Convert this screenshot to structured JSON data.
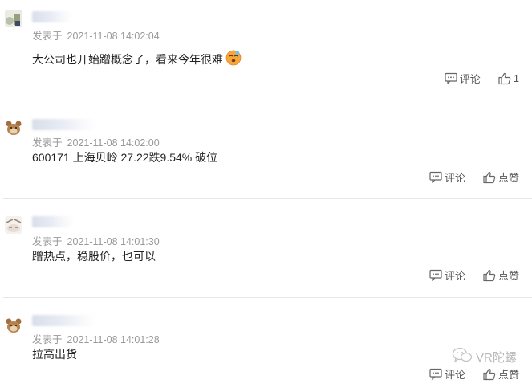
{
  "comments": [
    {
      "time_label": "发表于",
      "time": "2021-11-08 14:02:04",
      "content": "大公司也开始蹭概念了，看来今年很难",
      "has_emoji": true,
      "comment_label": "评论",
      "like_label": "1"
    },
    {
      "time_label": "发表于",
      "time": "2021-11-08 14:02:00",
      "content": "600171 上海贝岭 27.22跌9.54% 破位",
      "comment_label": "评论",
      "like_label": "点赞"
    },
    {
      "time_label": "发表于",
      "time": "2021-11-08 14:01:30",
      "content": "蹭热点，稳股价，也可以",
      "comment_label": "评论",
      "like_label": "点赞"
    },
    {
      "time_label": "发表于",
      "time": "2021-11-08 14:01:28",
      "content": "拉高出货",
      "comment_label": "评论",
      "like_label": "点赞"
    }
  ],
  "watermark": {
    "text": "VR陀螺"
  },
  "icons": {
    "comment": "comment-bubble-icon",
    "like": "thumbs-up-icon",
    "emoji": "sleepy-face-emoji-icon"
  },
  "colors": {
    "divider": "#e6e6e6",
    "meta": "#999999",
    "content": "#222222"
  }
}
